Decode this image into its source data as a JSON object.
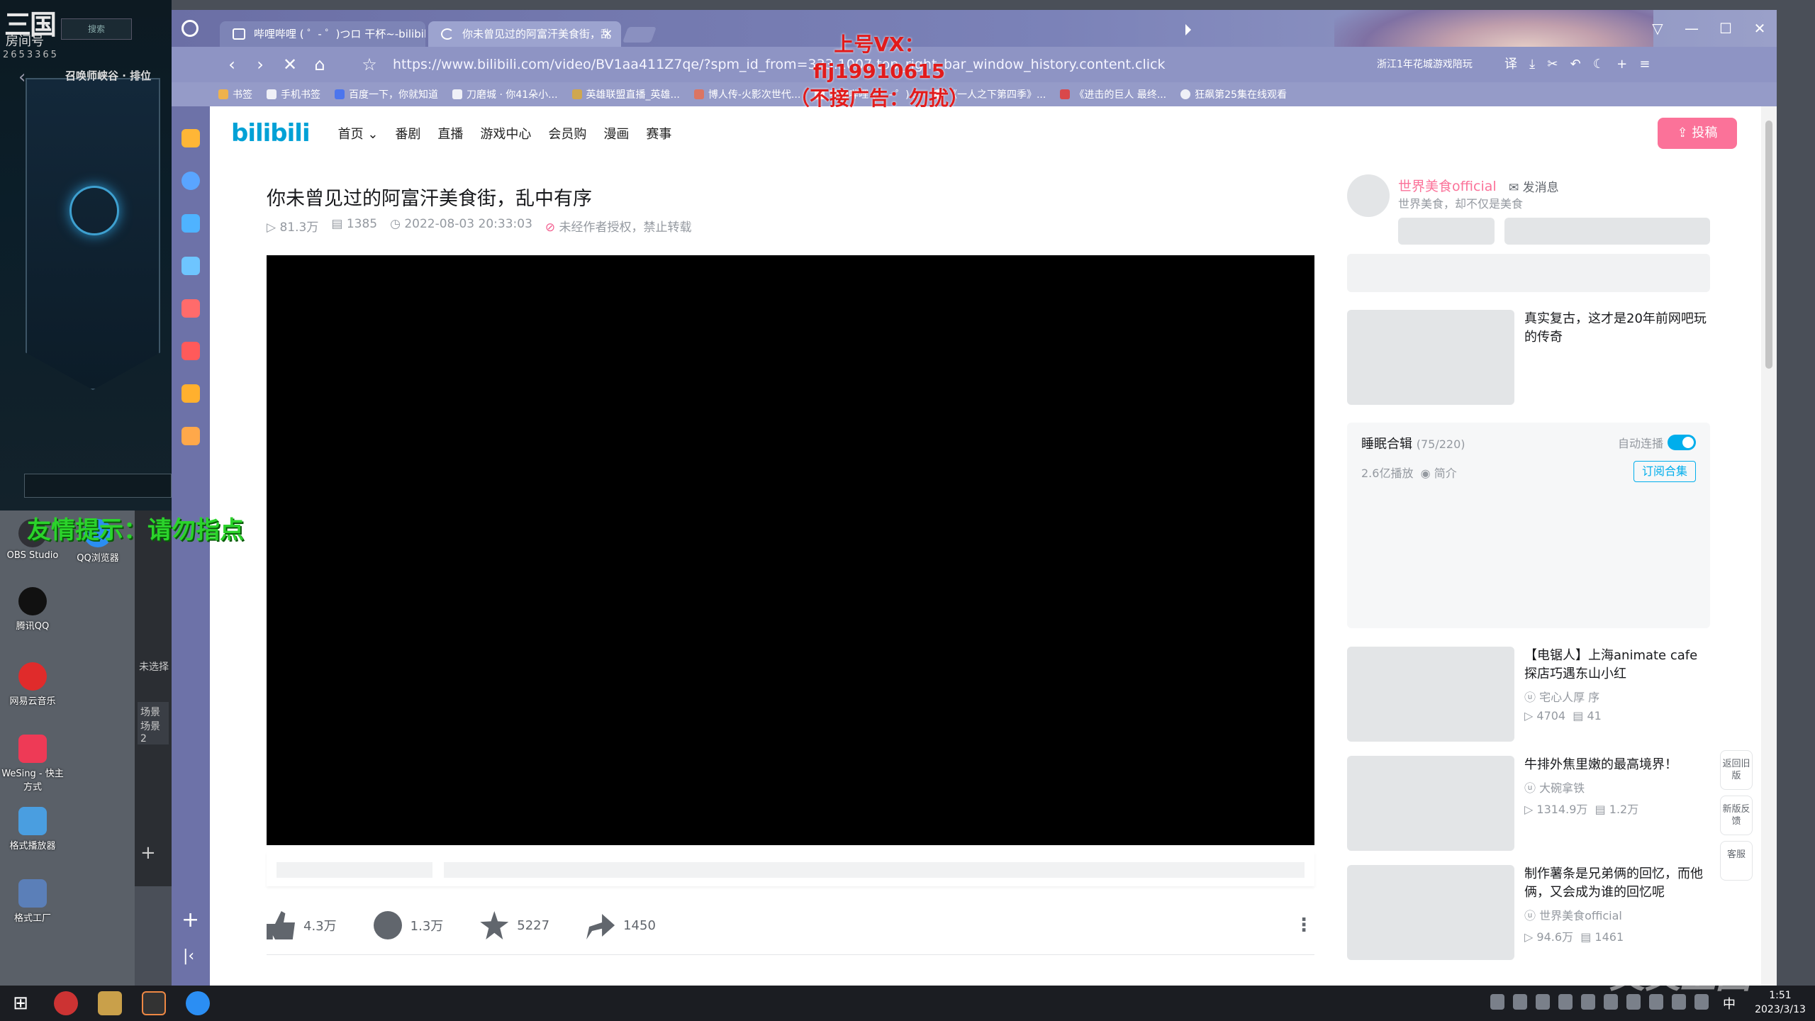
{
  "game": {
    "logo": "三国",
    "room_label": "房间号",
    "room_no": "2653365",
    "top_box": "搜索",
    "mode": "召唤师峡谷 · 排位"
  },
  "desktop": {
    "icons": [
      {
        "label": "OBS Studio",
        "color": "#303036"
      },
      {
        "label": "QQ浏览器",
        "color": "#2b8ef3"
      },
      {
        "label": "腾讯QQ",
        "color": "#111111"
      },
      {
        "label": "网易云音乐",
        "color": "#e02b2b"
      },
      {
        "label": "WeSing - 快主方式",
        "color": "#ee3a56"
      },
      {
        "label": "格式播放器",
        "color": "#4a9ee0"
      },
      {
        "label": "格式工厂",
        "color": "#5b7fb8"
      }
    ],
    "obs_unselected": "未选择",
    "obs_scenes": "场景\n场景 2"
  },
  "overlay": {
    "warning": "友情提示：请勿指点",
    "promo_line1": "上号VX：flj19910615",
    "promo_line2": "（不接广告：勿扰）",
    "watermark": "文文上国"
  },
  "browser": {
    "tabs": [
      {
        "title": "哔哩哔哩 ( ゜- ゜)つロ 干杯~-bilibili",
        "active": false
      },
      {
        "title": "你未曾见过的阿富汗美食街，乱",
        "active": true
      }
    ],
    "url": "https://www.bilibili.com/video/BV1aa411Z7qe/?spm_id_from=333.1007.top_right_bar_window_history.content.click",
    "address_extension": "浙江1年花城游戏陪玩",
    "window_controls": [
      "▽",
      "—",
      "☐",
      "✕"
    ],
    "bookmarks": [
      "书签",
      "手机书签",
      "百度一下，你就知道",
      "刀磨城 · 你41朵小...",
      "英雄联盟直播_英雄...",
      "博人传-火影次世代...",
      "哔哩哔哩 ( ゜- ゜)...",
      "《一人之下第四季》...",
      "《进击的巨人 最终...",
      "狂飙第25集在线观看"
    ],
    "sidebar_colors": [
      "#ffb636",
      "#5aa5ff",
      "#4fb3ff",
      "#6ec5ff",
      "#ff6b6b",
      "#ff5a5a",
      "#ffb02e",
      "#ffa84a"
    ]
  },
  "bili": {
    "logo": "bilibili",
    "nav": [
      "首页 ⌄",
      "番剧",
      "直播",
      "游戏中心",
      "会员购",
      "漫画",
      "赛事"
    ],
    "upload": "⇪ 投稿",
    "video": {
      "title": "你未曾见过的阿富汗美食街，乱中有序",
      "views": "81.3万",
      "danmaku": "1385",
      "date": "2022-08-03 20:33:03",
      "copyright": "未经作者授权，禁止转载"
    },
    "actions": {
      "like": "4.3万",
      "coin": "1.3万",
      "favorite": "5227",
      "share": "1450"
    },
    "uploader": {
      "name": "世界美食official",
      "send_message": "✉ 发消息",
      "desc": "世界美食，却不仅是美食"
    },
    "first_rec": "真实复古，这才是20年前网吧玩的传奇",
    "collection": {
      "title": "睡眠合辑",
      "progress": "(75/220)",
      "autoplay": "自动连播",
      "plays": "2.6亿播放",
      "intro": "简介",
      "subscribe": "订阅合集"
    },
    "recommendations": [
      {
        "title": "【电锯人】上海animate cafe探店巧遇东山小红",
        "up": "宅心人厚 序",
        "views": "4704",
        "danmaku": "41"
      },
      {
        "title": "牛排外焦里嫩的最高境界！",
        "up": "大碗拿铁",
        "views": "1314.9万",
        "danmaku": "1.2万"
      },
      {
        "title": "制作薯条是兄弟俩的回忆，而他俩，又会成为谁的回忆呢",
        "up": "世界美食official",
        "views": "94.6万",
        "danmaku": "1461"
      }
    ],
    "float_buttons": [
      "返回旧版",
      "新版反馈",
      "客服"
    ]
  },
  "taskbar": {
    "ime": "中",
    "time": "1:51",
    "date": "2023/3/13"
  }
}
